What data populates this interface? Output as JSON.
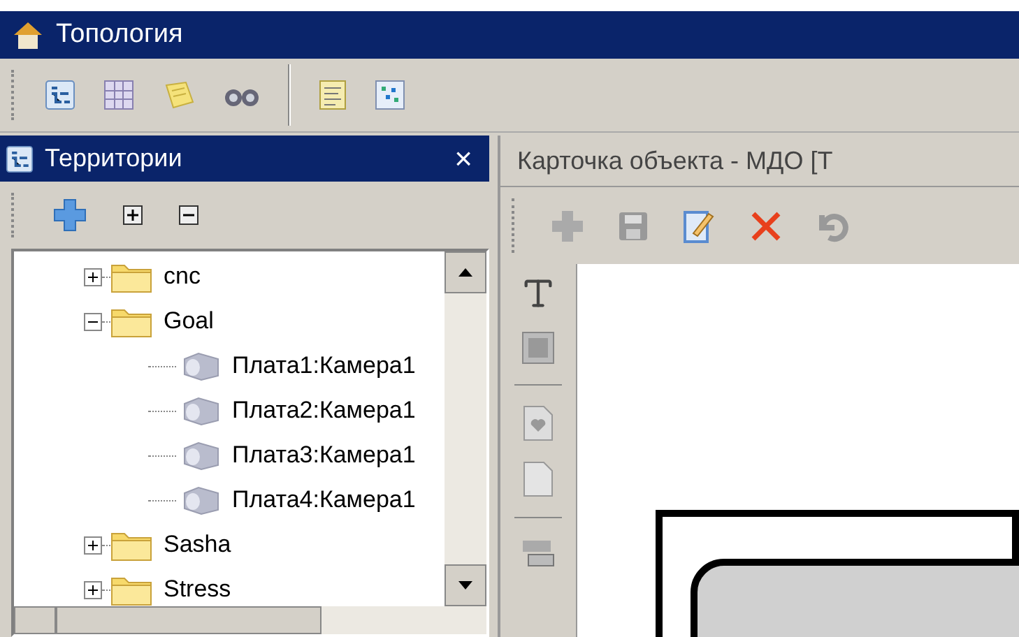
{
  "window": {
    "title": "Топология"
  },
  "territories_panel": {
    "title": "Территории",
    "close": "×",
    "tree": [
      {
        "label": "cnc",
        "kind": "folder",
        "expanded": false
      },
      {
        "label": "Goal",
        "kind": "folder",
        "expanded": true,
        "children": [
          {
            "label": "Плата1:Камера1",
            "kind": "camera"
          },
          {
            "label": "Плата2:Камера1",
            "kind": "camera"
          },
          {
            "label": "Плата3:Камера1",
            "kind": "camera"
          },
          {
            "label": "Плата4:Камера1",
            "kind": "camera"
          }
        ]
      },
      {
        "label": "Sasha",
        "kind": "folder",
        "expanded": false
      },
      {
        "label": "Stress",
        "kind": "folder",
        "expanded": false
      }
    ]
  },
  "object_card": {
    "title": "Карточка объекта - МДО [Т"
  }
}
